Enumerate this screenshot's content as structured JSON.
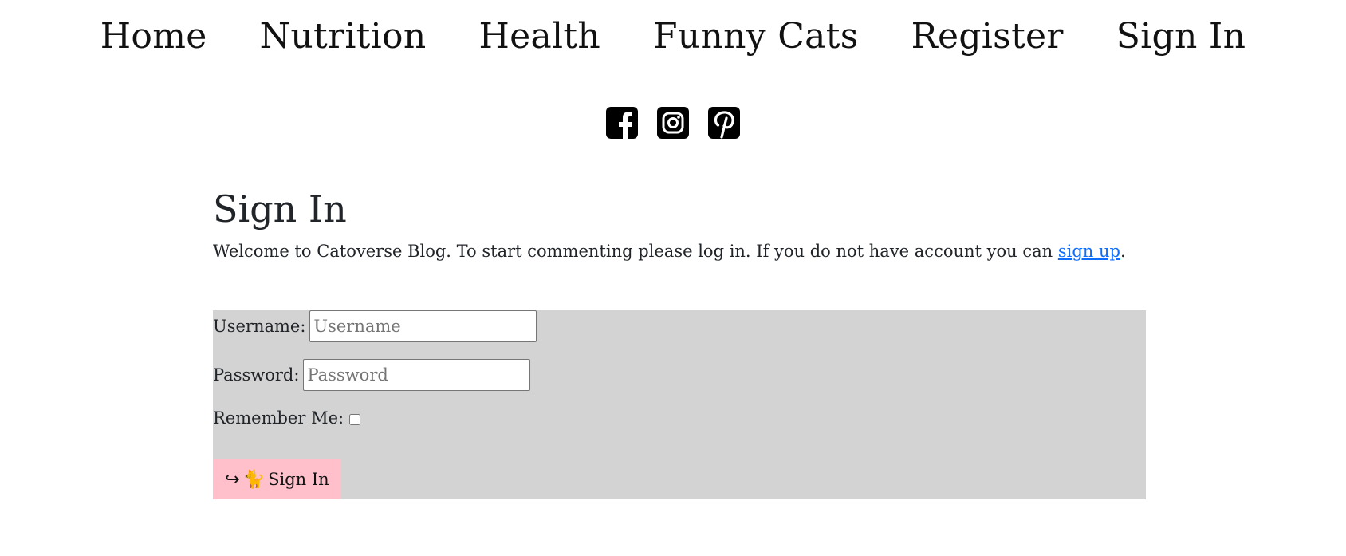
{
  "nav": {
    "items": [
      {
        "label": "Home"
      },
      {
        "label": "Nutrition"
      },
      {
        "label": "Health"
      },
      {
        "label": "Funny Cats"
      },
      {
        "label": "Register"
      },
      {
        "label": "Sign In"
      }
    ]
  },
  "social": {
    "icons": [
      "facebook-icon",
      "instagram-icon",
      "pinterest-icon"
    ]
  },
  "page": {
    "title": "Sign In",
    "intro_text": "Welcome to Catoverse Blog. To start commenting please log in. If you do not have account you can ",
    "signup_link": "sign up",
    "intro_end": "."
  },
  "form": {
    "username_label": "Username:",
    "username_placeholder": "Username",
    "username_value": "",
    "password_label": "Password:",
    "password_placeholder": "Password",
    "password_value": "",
    "remember_label": "Remember Me:",
    "remember_checked": false,
    "submit_arrow": "↪",
    "submit_cat": "🐈",
    "submit_label": "Sign In"
  },
  "colors": {
    "form_background": "#d3d3d3",
    "button_background": "#ffc0cb",
    "link": "#0d6efd"
  }
}
